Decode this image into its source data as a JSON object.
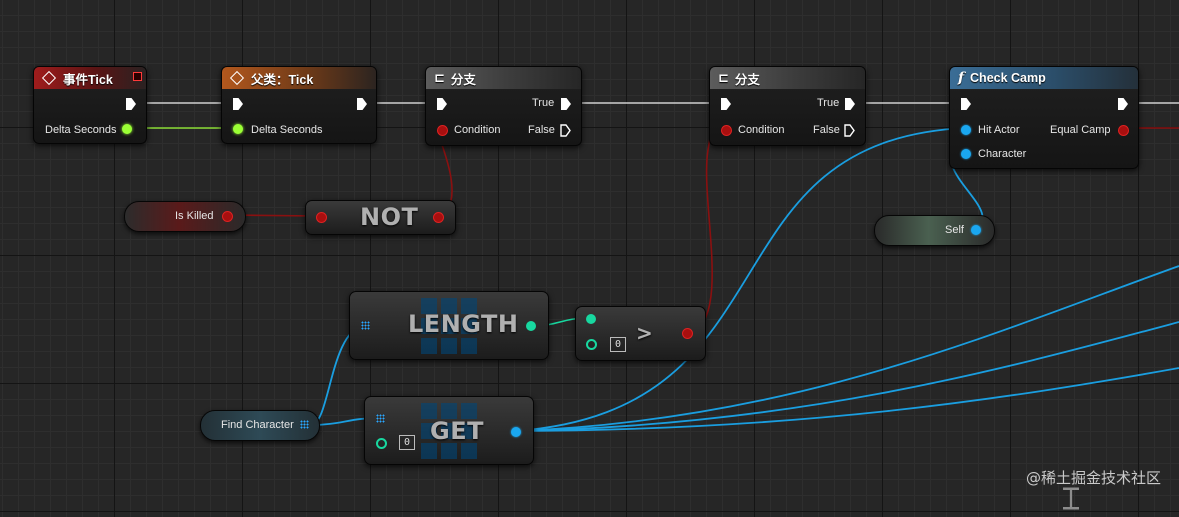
{
  "nodes": {
    "event_tick": {
      "title": "事件Tick",
      "pin_delta": "Delta Seconds"
    },
    "parent_tick": {
      "title": "父类：Tick",
      "pin_delta": "Delta Seconds"
    },
    "branch1": {
      "title": "分支",
      "pin_condition": "Condition",
      "pin_true": "True",
      "pin_false": "False"
    },
    "branch2": {
      "title": "分支",
      "pin_condition": "Condition",
      "pin_true": "True",
      "pin_false": "False"
    },
    "check_camp": {
      "title": "Check Camp",
      "pin_hit_actor": "Hit Actor",
      "pin_character": "Character",
      "pin_equal_camp": "Equal Camp"
    },
    "is_killed": {
      "label": "Is Killed"
    },
    "not_node": {
      "label": "NOT"
    },
    "self_ref": {
      "label": "Self"
    },
    "length_node": {
      "label": "LENGTH"
    },
    "greater_node": {
      "symbol": ">",
      "value": "0"
    },
    "find_character": {
      "label": "Find Character"
    },
    "get_node": {
      "label": "GET",
      "index": "0"
    }
  },
  "watermark": "@稀土掘金技术社区",
  "colors": {
    "exec": "#ffffff",
    "float_pin": "#9bff35",
    "bool_pin": "#a80f0f",
    "object_pin": "#1aa7f0",
    "int_pin": "#18d8a0"
  }
}
